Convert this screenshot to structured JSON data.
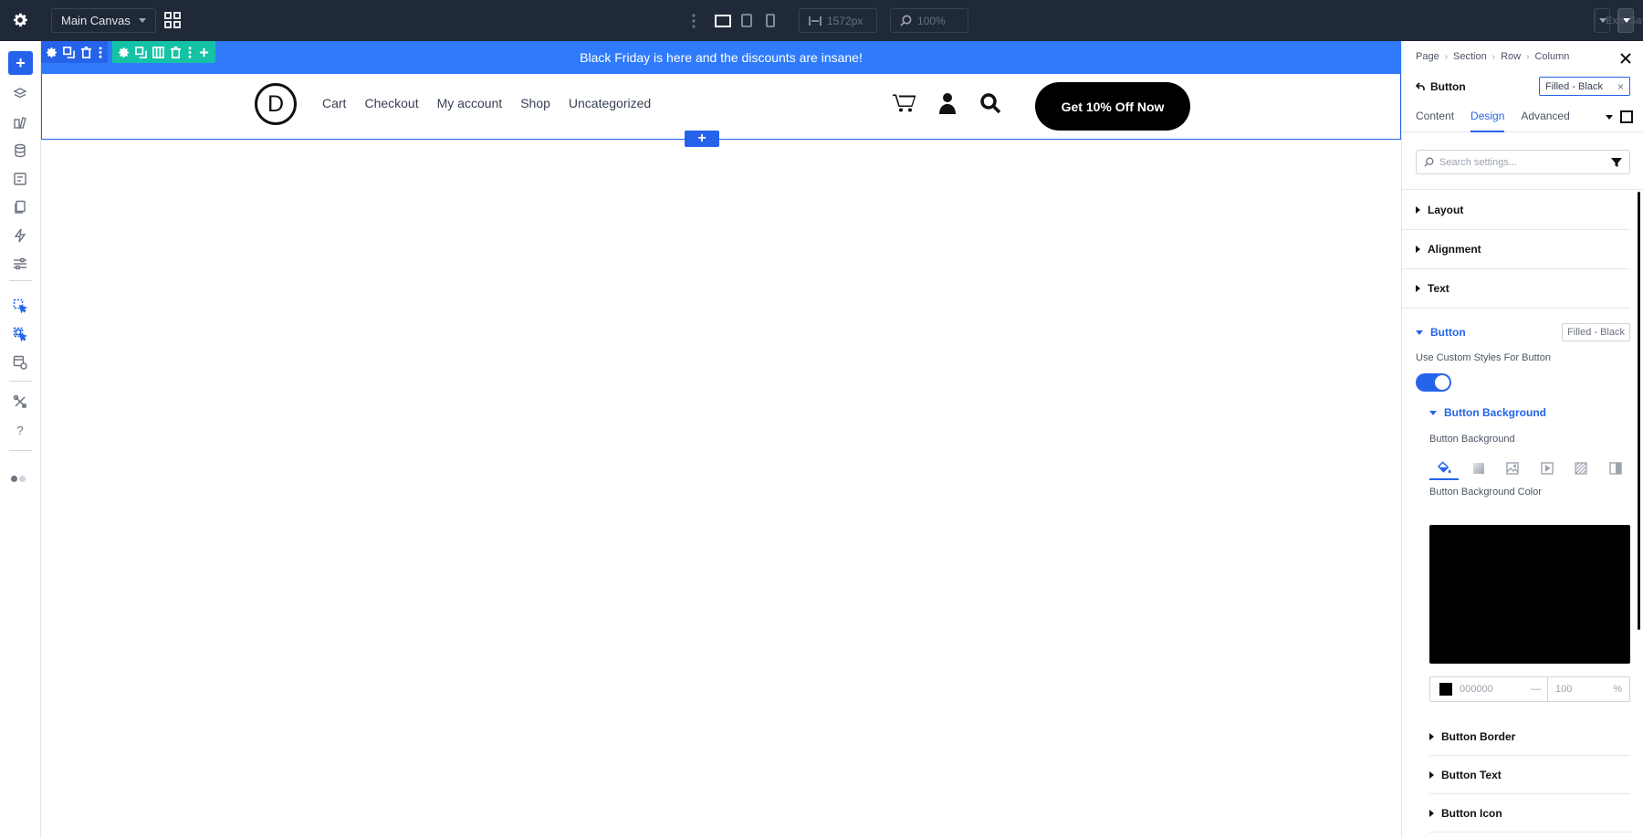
{
  "topbar": {
    "canvas_name": "Main Canvas",
    "width_value": "1572px",
    "zoom_value": "100%",
    "exit_label": "Exit",
    "save_label": "Save"
  },
  "promo": {
    "text": "Black Friday is here and the discounts are insane!"
  },
  "header": {
    "logo_letter": "D",
    "menu": [
      "Cart",
      "Checkout",
      "My account",
      "Shop",
      "Uncategorized"
    ],
    "cta_label": "Get 10% Off Now"
  },
  "panel": {
    "breadcrumbs": [
      "Page",
      "Section",
      "Row",
      "Column"
    ],
    "element_title": "Button",
    "preset_label": "Filled - Black",
    "tabs": [
      "Content",
      "Design",
      "Advanced"
    ],
    "active_tab": "Design",
    "search_placeholder": "Search settings...",
    "sections": [
      "Layout",
      "Alignment",
      "Text"
    ],
    "button_section": {
      "title": "Button",
      "preset": "Filled - Black",
      "custom_styles_label": "Use Custom Styles For Button",
      "custom_styles_enabled": true,
      "background_group": "Button Background",
      "background_label": "Button Background",
      "background_color_label": "Button Background Color",
      "color_hex": "000000",
      "color_swatch": "#000000",
      "opacity_value": "100",
      "opacity_unit": "%",
      "dash": "—"
    },
    "sub_sections": [
      "Button Border",
      "Button Text",
      "Button Icon"
    ]
  },
  "colors": {
    "accent": "#2563eb",
    "promo": "#2f7bfb",
    "column_tools": "#14c3a5",
    "topbar": "#1f2937"
  }
}
